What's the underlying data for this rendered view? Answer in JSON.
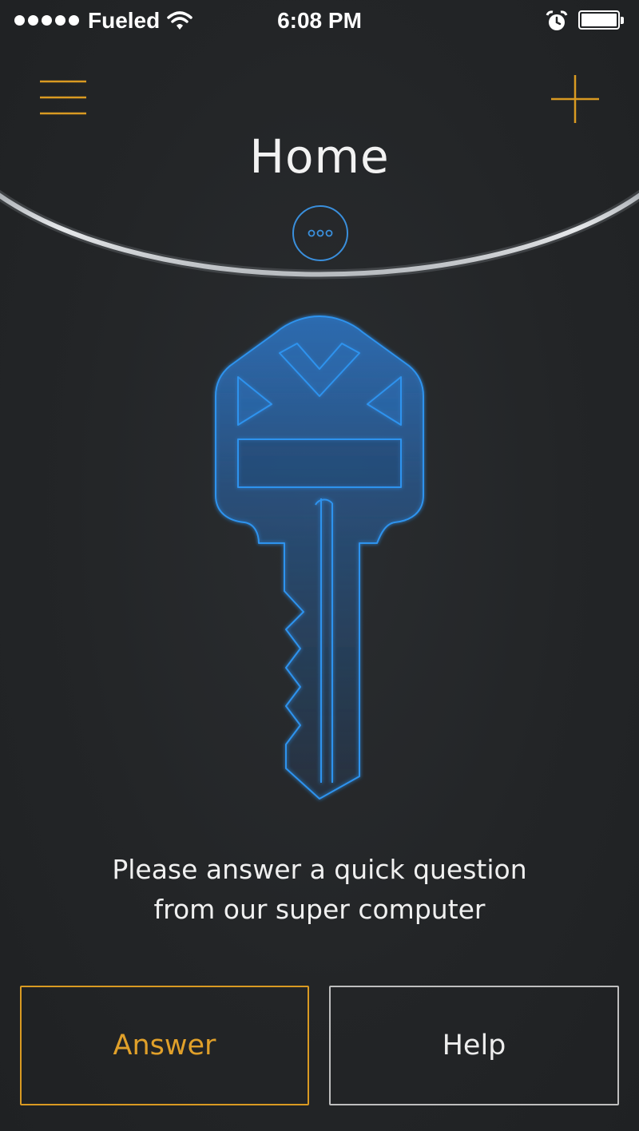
{
  "status_bar": {
    "carrier": "Fueled",
    "time": "6:08 PM",
    "signal_icon": "signal-dots-icon",
    "wifi_icon": "wifi-icon",
    "alarm_icon": "alarm-clock-icon",
    "battery_icon": "battery-icon",
    "battery_level": 1.0
  },
  "nav": {
    "menu_icon": "hamburger-menu-icon",
    "add_icon": "plus-icon",
    "title": "Home",
    "more_icon": "ellipsis-icon"
  },
  "illustration": {
    "icon": "key-icon"
  },
  "prompt": {
    "line1": "Please answer a quick question",
    "line2": "from our super computer"
  },
  "actions": {
    "answer_label": "Answer",
    "help_label": "Help"
  },
  "colors": {
    "background": "#232527",
    "accent": "#e0a02a",
    "key_blue": "#2d8fe0",
    "text": "#f0f0f0"
  }
}
